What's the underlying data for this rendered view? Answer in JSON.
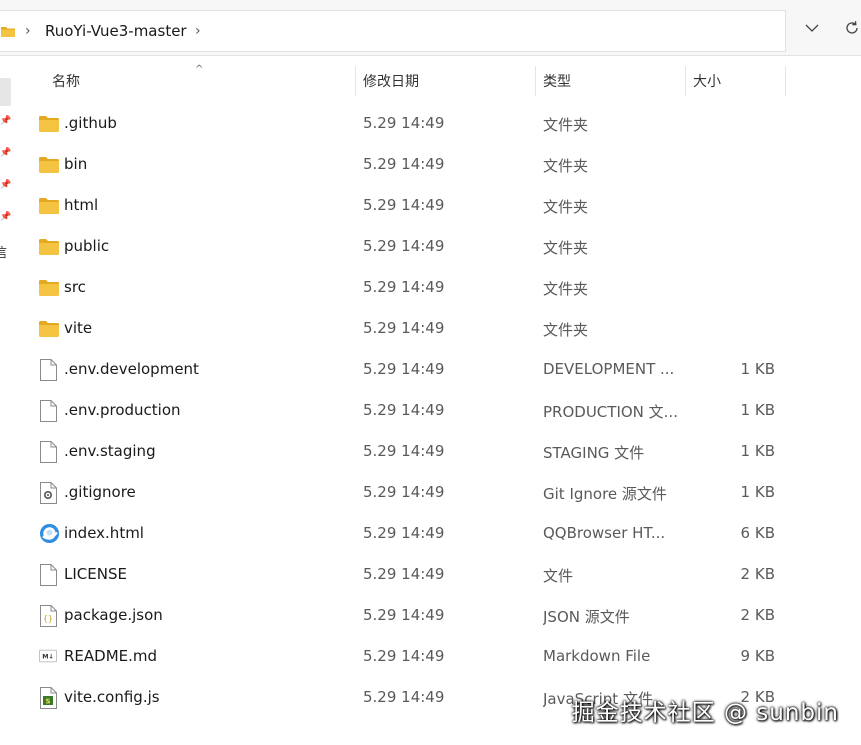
{
  "address": {
    "path": "RuoYi-Vue3-master"
  },
  "columns": {
    "name": "名称",
    "date": "修改日期",
    "type": "类型",
    "size": "大小"
  },
  "sidebar_fragment": "信",
  "files": [
    {
      "name": ".github",
      "date": "5.29 14:49",
      "type": "文件夹",
      "size": "",
      "icon": "folder-icon"
    },
    {
      "name": "bin",
      "date": "5.29 14:49",
      "type": "文件夹",
      "size": "",
      "icon": "folder-icon"
    },
    {
      "name": "html",
      "date": "5.29 14:49",
      "type": "文件夹",
      "size": "",
      "icon": "folder-icon"
    },
    {
      "name": "public",
      "date": "5.29 14:49",
      "type": "文件夹",
      "size": "",
      "icon": "folder-icon"
    },
    {
      "name": "src",
      "date": "5.29 14:49",
      "type": "文件夹",
      "size": "",
      "icon": "folder-icon"
    },
    {
      "name": "vite",
      "date": "5.29 14:49",
      "type": "文件夹",
      "size": "",
      "icon": "folder-icon"
    },
    {
      "name": ".env.development",
      "date": "5.29 14:49",
      "type": "DEVELOPMENT ...",
      "size": "1 KB",
      "icon": "file-icon"
    },
    {
      "name": ".env.production",
      "date": "5.29 14:49",
      "type": "PRODUCTION 文...",
      "size": "1 KB",
      "icon": "file-icon"
    },
    {
      "name": ".env.staging",
      "date": "5.29 14:49",
      "type": "STAGING 文件",
      "size": "1 KB",
      "icon": "file-icon"
    },
    {
      "name": ".gitignore",
      "date": "5.29 14:49",
      "type": "Git Ignore 源文件",
      "size": "1 KB",
      "icon": "gear-file-icon"
    },
    {
      "name": "index.html",
      "date": "5.29 14:49",
      "type": "QQBrowser HT...",
      "size": "6 KB",
      "icon": "browser-icon"
    },
    {
      "name": "LICENSE",
      "date": "5.29 14:49",
      "type": "文件",
      "size": "2 KB",
      "icon": "file-icon"
    },
    {
      "name": "package.json",
      "date": "5.29 14:49",
      "type": "JSON 源文件",
      "size": "2 KB",
      "icon": "json-file-icon"
    },
    {
      "name": "README.md",
      "date": "5.29 14:49",
      "type": "Markdown File",
      "size": "9 KB",
      "icon": "markdown-icon"
    },
    {
      "name": "vite.config.js",
      "date": "5.29 14:49",
      "type": "JavaScript 文件",
      "size": "2 KB",
      "icon": "js-file-icon"
    }
  ],
  "watermark": "掘金技术社区 @ sunbin",
  "colors": {
    "folder": "#f5c342",
    "folder_dark": "#e3a920",
    "selection_strip": "#e6e6e6"
  }
}
